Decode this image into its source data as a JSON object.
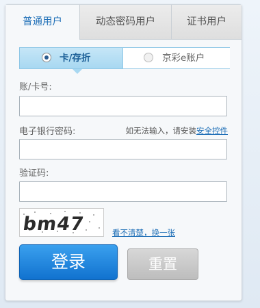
{
  "tabs": [
    {
      "label": "普通用户",
      "active": true
    },
    {
      "label": "动态密码用户",
      "active": false
    },
    {
      "label": "证书用户",
      "active": false
    }
  ],
  "account_type": {
    "option1": "卡/存折",
    "option2": "京彩e账户",
    "selected": "卡/存折"
  },
  "fields": {
    "card_label": "账/卡号:",
    "card_value": "",
    "password_label": "电子银行密码:",
    "password_hint": "如无法输入，请安装",
    "password_hint_link": "安全控件",
    "password_value": "",
    "captcha_label": "验证码:",
    "captcha_value": ""
  },
  "captcha": {
    "image_text": "bm47",
    "refresh_label": "看不清楚，换一张"
  },
  "buttons": {
    "login": "登录",
    "reset": "重置"
  },
  "colors": {
    "accent": "#1f6fb7",
    "login_button": "#1b86df",
    "selected_option_bg": "#a8d8f1"
  }
}
